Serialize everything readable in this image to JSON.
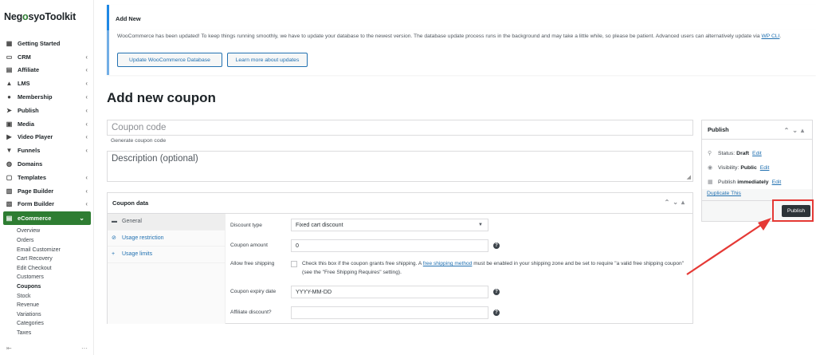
{
  "brand": {
    "name_prefix": "Neg",
    "name_o": "o",
    "name_suffix": "syoToolkit"
  },
  "sidebar": {
    "items": [
      {
        "label": "Getting Started",
        "icon": "grid-icon",
        "chev": ""
      },
      {
        "label": "CRM",
        "icon": "crm-icon",
        "chev": "‹"
      },
      {
        "label": "Affiliate",
        "icon": "affiliate-icon",
        "chev": "‹"
      },
      {
        "label": "LMS",
        "icon": "graduation-cap-icon",
        "chev": "‹"
      },
      {
        "label": "Membership",
        "icon": "users-icon",
        "chev": "‹"
      },
      {
        "label": "Publish",
        "icon": "paper-plane-icon",
        "chev": "‹"
      },
      {
        "label": "Media",
        "icon": "image-icon",
        "chev": "‹"
      },
      {
        "label": "Video Player",
        "icon": "play-icon",
        "chev": "‹"
      },
      {
        "label": "Funnels",
        "icon": "funnel-icon",
        "chev": "‹"
      },
      {
        "label": "Domains",
        "icon": "globe-icon",
        "chev": ""
      },
      {
        "label": "Templates",
        "icon": "templates-icon",
        "chev": "‹"
      },
      {
        "label": "Page Builder",
        "icon": "page-builder-icon",
        "chev": "‹"
      },
      {
        "label": "Form Builder",
        "icon": "form-icon",
        "chev": "‹"
      },
      {
        "label": "eCommerce",
        "icon": "ecommerce-icon",
        "chev": "⌄"
      }
    ],
    "subitems": [
      "Overview",
      "Orders",
      "Email Customizer",
      "Cart Recovery",
      "Edit Checkout",
      "Customers",
      "Coupons",
      "Stock",
      "Revenue",
      "Variations",
      "Categories",
      "Taxes"
    ]
  },
  "topbar": {
    "title": "Add New"
  },
  "notice": {
    "text": "WooCommerce has been updated! To keep things running smoothly, we have to update your database to the newest version. The database update process runs in the background and may take a little while, so please be patient. Advanced users can alternatively update via",
    "link": "WP CLI",
    "end": ".",
    "btn_update": "Update WooCommerce Database",
    "btn_learn": "Learn more about updates"
  },
  "page_title": "Add new coupon",
  "coupon_code": {
    "placeholder": "Coupon code",
    "hint": "Generate coupon code"
  },
  "description": {
    "placeholder": "Description (optional)"
  },
  "coupon_data": {
    "title": "Coupon data",
    "tabs": [
      {
        "label": "General",
        "icon": "ticket-icon"
      },
      {
        "label": "Usage restriction",
        "icon": "block-icon"
      },
      {
        "label": "Usage limits",
        "icon": "plus-icon"
      }
    ],
    "discount_type_label": "Discount type",
    "discount_type_value": "Fixed cart discount",
    "coupon_amount_label": "Coupon amount",
    "coupon_amount_value": "0",
    "free_shipping_label": "Allow free shipping",
    "free_shipping_text_pre": "Check this box if the coupon grants free shipping. A",
    "free_shipping_link": "free shipping method",
    "free_shipping_text_post": "must be enabled in your shipping zone and be set to require \"a valid free shipping coupon\" (see the \"Free Shipping Requires\" setting).",
    "expiry_label": "Coupon expiry date",
    "expiry_placeholder": "YYYY-MM-DD",
    "affiliate_label": "Affiliate discount?",
    "affiliate_value": ""
  },
  "publish": {
    "title": "Publish",
    "status_label": "Status:",
    "status_value": "Draft",
    "visibility_label": "Visibility:",
    "visibility_value": "Public",
    "publish_label": "Publish",
    "publish_value": "immediately",
    "edit": "Edit",
    "duplicate": "Duplicate This",
    "button": "Publish"
  },
  "colors": {
    "brand_green": "#2e7d32",
    "link_blue": "#2271b1",
    "highlight_red": "#e53935"
  }
}
